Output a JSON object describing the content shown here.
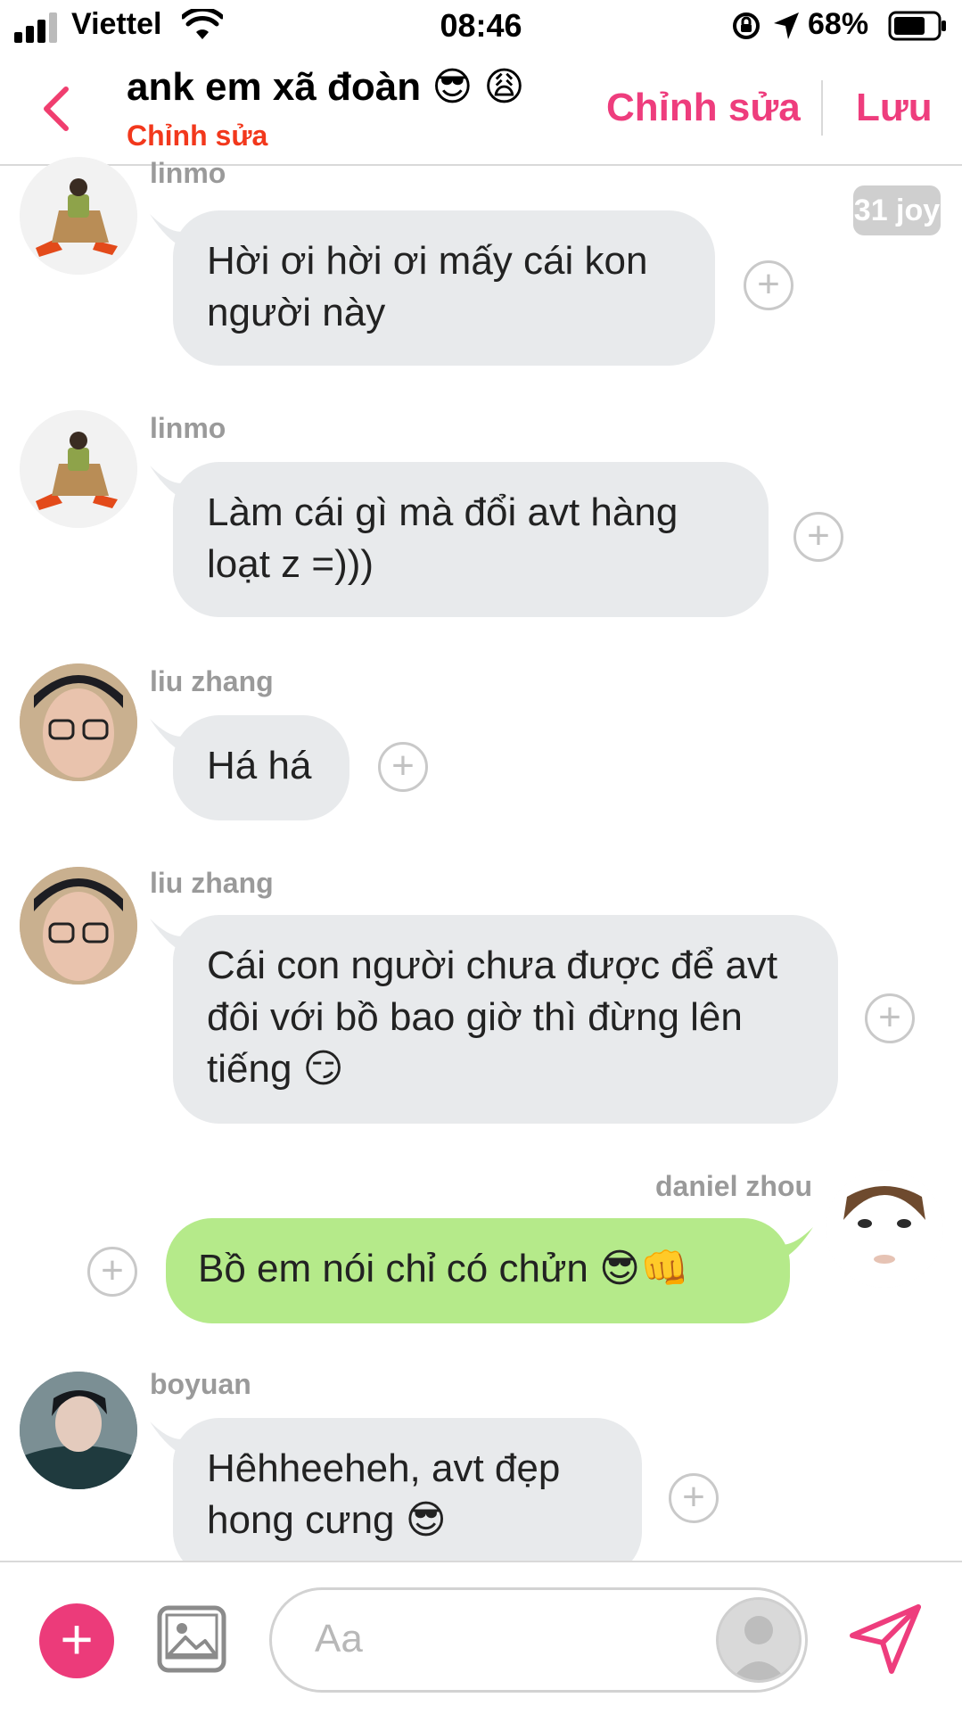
{
  "status_bar": {
    "carrier": "Viettel",
    "time": "08:46",
    "battery": "68%"
  },
  "header": {
    "title": "ank em xã đoàn 😎 😩",
    "subtitle": "Chỉnh sửa",
    "edit_label": "Chỉnh sửa",
    "save_label": "Lưu",
    "back_icon": "chevron-left-icon"
  },
  "badge": "31 joy",
  "messages": [
    {
      "sender": "linmo",
      "text": "Hời ơi hời ơi mấy cái kon người này",
      "direction": "in"
    },
    {
      "sender": "linmo",
      "text": "Làm cái gì mà đổi avt hàng loạt z =)))",
      "direction": "in"
    },
    {
      "sender": "liu zhang",
      "text": "Há há",
      "direction": "in"
    },
    {
      "sender": "liu zhang",
      "text": "Cái con người chưa được để avt đôi với bồ bao giờ thì đừng lên tiếng 😏",
      "direction": "in"
    },
    {
      "sender": "daniel zhou",
      "text": "Bồ em nói chỉ có chửn 😎👊",
      "direction": "out"
    },
    {
      "sender": "boyuan",
      "text": "Hêhheeheh, avt đẹp hong cưng 😎",
      "direction": "in"
    }
  ],
  "reaction_plus": "+",
  "composer": {
    "placeholder": "Aa",
    "add_symbol": "+"
  },
  "colors": {
    "accent": "#ee3d7d",
    "subtitle": "#f2381c",
    "incoming": "#e8eaec",
    "outgoing": "#b5ea8a"
  }
}
